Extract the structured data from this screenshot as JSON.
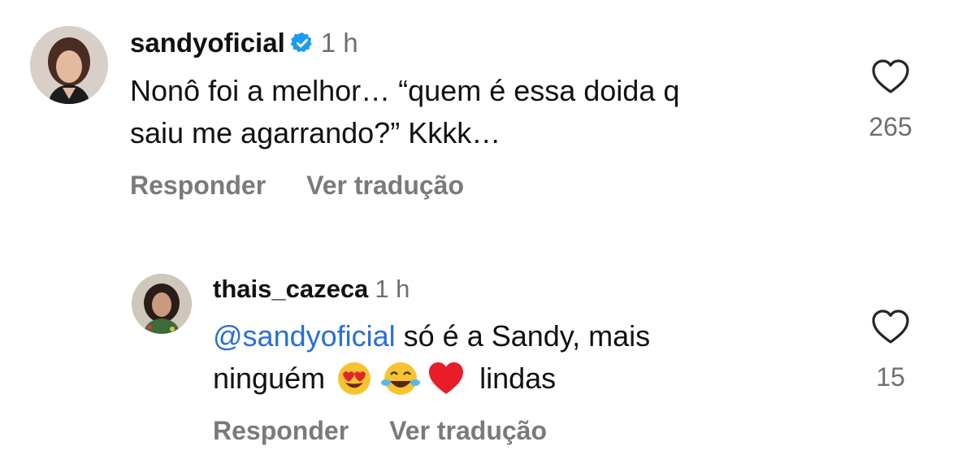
{
  "comments": [
    {
      "username": "sandyoficial",
      "time": "1 h",
      "text_line1": "Nonô foi a melhor… “quem é essa doida q",
      "text_line2": "saiu me agarrando?” Kkkk…",
      "likes": "265",
      "reply_label": "Responder",
      "translate_label": "Ver tradução"
    },
    {
      "username": "thais_cazeca",
      "time": "1 h",
      "mention": "@sandyoficial",
      "text_line1_rest": " só é a Sandy, mais",
      "text_line2_start": "ninguém",
      "text_line2_end": "lindas",
      "likes": "15",
      "reply_label": "Responder",
      "translate_label": "Ver tradução"
    }
  ],
  "icons": {
    "verified_color": "#1d9bf0",
    "heart_outline_color": "#262626",
    "mention_color": "#2a6ed6"
  }
}
